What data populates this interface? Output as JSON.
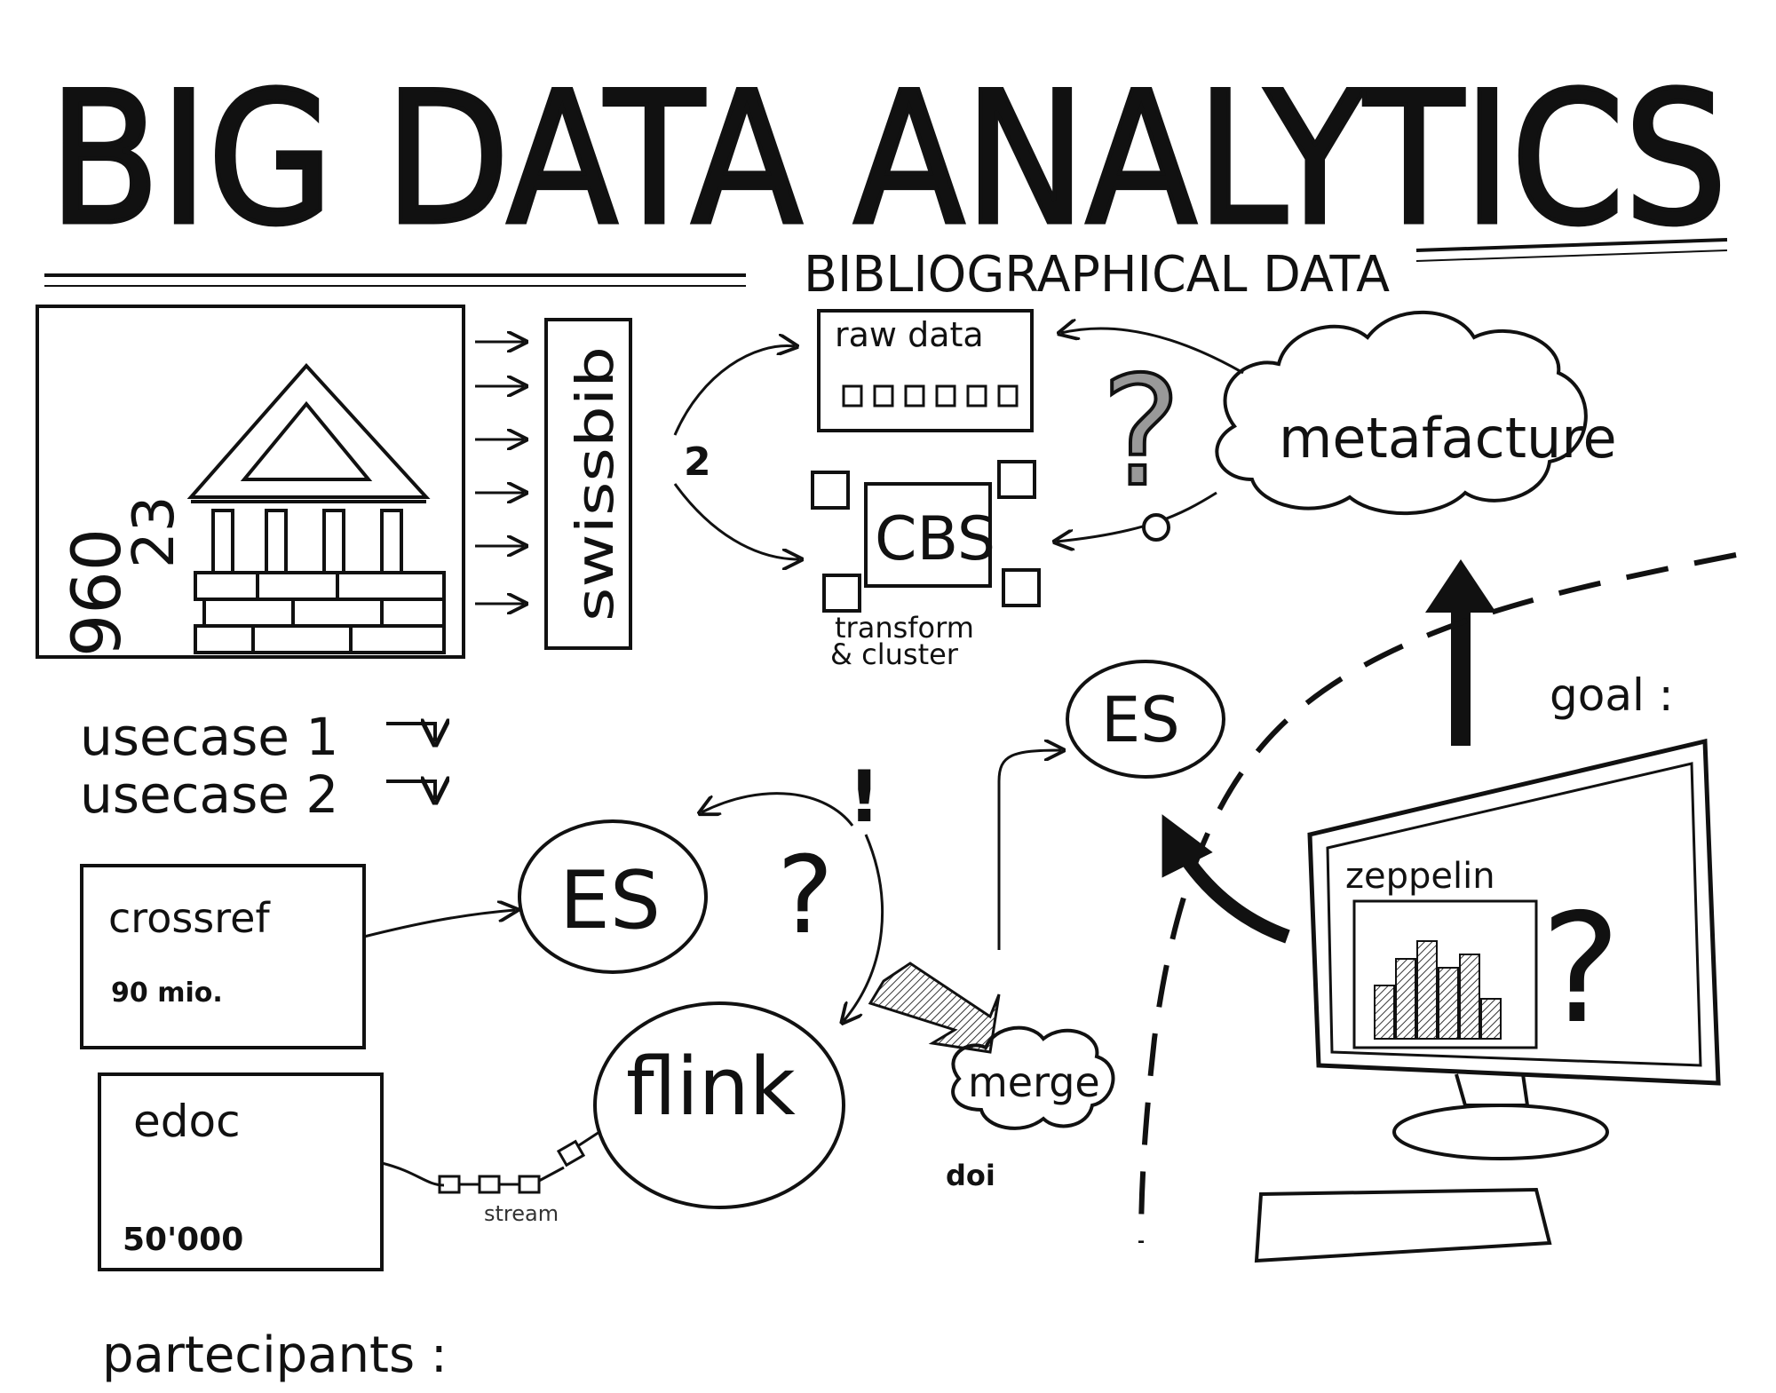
{
  "title": "BIG DATA ANALYTICS",
  "subtitle": "BIBLIOGRAPHICAL DATA",
  "library": {
    "count1": "960",
    "count2": "23"
  },
  "swissbib": "swissbib",
  "branch_number": "2",
  "raw_data": "raw data",
  "cbs": "CBS",
  "transform_cluster": [
    "transform",
    "& cluster"
  ],
  "metafacture": "metafacture",
  "usecases": [
    "usecase 1",
    "usecase 2"
  ],
  "es_labels": [
    "ES",
    "ES"
  ],
  "crossref": {
    "name": "crossref",
    "count": "90 mio."
  },
  "edoc": {
    "name": "edoc",
    "count": "50'000"
  },
  "flink": "flink",
  "stream_label": "stream",
  "merge": "merge",
  "doi": "doi",
  "goal": "goal :",
  "zeppelin": "zeppelin",
  "participants_label": "partecipants :",
  "exclamation": "!",
  "question_mark": "?"
}
